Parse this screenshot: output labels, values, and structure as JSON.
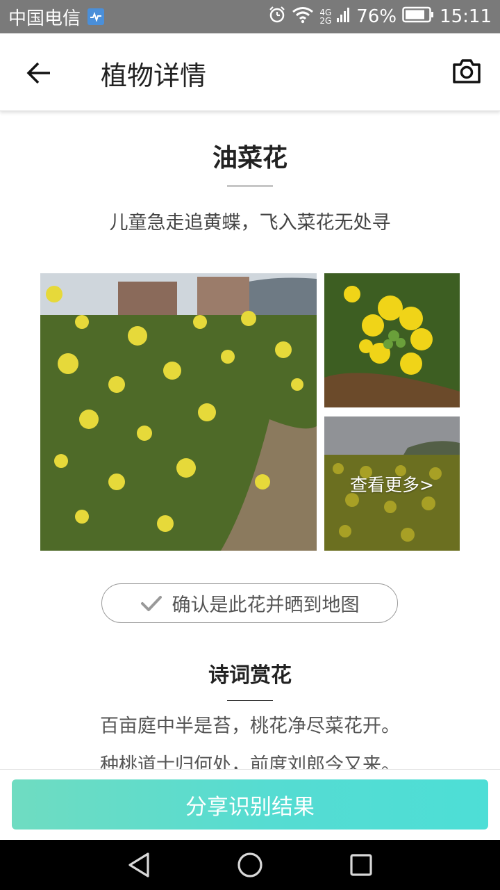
{
  "status_bar": {
    "carrier": "中国电信",
    "network_top": "4G",
    "network_bottom": "2G",
    "battery": "76%",
    "time": "15:11"
  },
  "header": {
    "title": "植物详情",
    "back_icon": "arrow-left-icon",
    "camera_icon": "camera-icon"
  },
  "plant": {
    "name": "油菜花",
    "poem_line": "儿童急走追黄蝶，飞入菜花无处寻"
  },
  "gallery": {
    "more_label": "查看更多>"
  },
  "confirm": {
    "label": "确认是此花并晒到地图",
    "icon": "checkmark-icon"
  },
  "poetry_section": {
    "title": "诗词赏花",
    "lines": [
      "百亩庭中半是苔，桃花净尽菜花开。",
      "种桃道士归何处，前度刘郎今又来。"
    ]
  },
  "share": {
    "label": "分享识别结果"
  },
  "colors": {
    "status_bar": "#7a7a7a",
    "share_gradient_start": "#6fdcc1",
    "share_gradient_end": "#4dded6",
    "nav_bar": "#000000"
  }
}
